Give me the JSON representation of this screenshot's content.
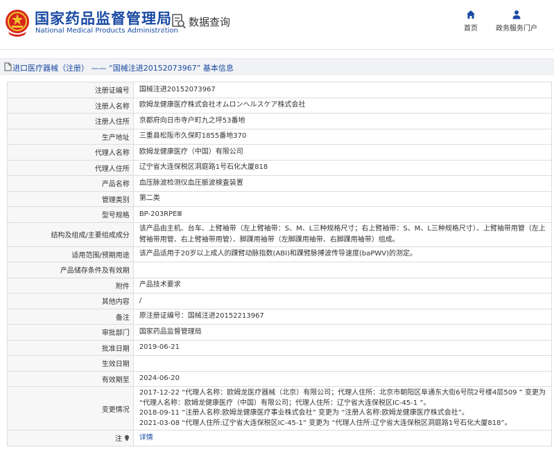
{
  "header": {
    "brand_cn": "国家药品监督管理局",
    "brand_en": "National Medical Products Administration",
    "query_title": "数据查询",
    "nav": [
      {
        "label": "首页",
        "icon": "home-icon"
      },
      {
        "label": "政务服务门户",
        "icon": "user-icon"
      }
    ]
  },
  "breadcrumb": {
    "text": "进口医疗器械（注册） —— “国械注进20152073967” 基本信息"
  },
  "colors": {
    "brand_blue": "#1a4aa3",
    "emblem_red": "#d7261e",
    "emblem_gold": "#f4c430",
    "label_bg": "#f7f7f7",
    "border": "#dcdcdc"
  },
  "detail": {
    "rows": [
      {
        "label": "注册证编号",
        "value": "国械注进20152073967"
      },
      {
        "label": "注册人名称",
        "value": "欧姆龙健康医疗株式会社オムロンヘルスケア株式会社"
      },
      {
        "label": "注册人住所",
        "value": "京都府向日市寺户町九之坪53番地"
      },
      {
        "label": "生产地址",
        "value": "三重县松阪市久保町1855番地370"
      },
      {
        "label": "代理人名称",
        "value": "欧姆龙健康医疗（中国）有限公司"
      },
      {
        "label": "代理人住所",
        "value": "辽宁省大连保税区洞庭路1号石化大厦818"
      },
      {
        "label": "产品名称",
        "value": "血压脉波检测仪血圧脈波検査装置"
      },
      {
        "label": "管理类别",
        "value": "第二类"
      },
      {
        "label": "型号规格",
        "value": "BP-203RPEⅢ"
      },
      {
        "label": "结构及组成/主要组成成分",
        "value": "该产品由主机、台车、上臂袖带（左上臂袖带：S、M、L三种规格尺寸；右上臂袖带：S、M、L三种规格尺寸）、上臂袖带用管（左上臂袖带用管、右上臂袖带用管）、脚踝用袖带（左脚踝用袖带、右脚踝用袖带）组成。"
      },
      {
        "label": "适用范围/预期用途",
        "value": "该产品适用于20岁以上成人的踝臂动脉指数(ABI)和踝臂脉搏波传导速度(baPWV)的测定。"
      },
      {
        "label": "产品储存条件及有效期",
        "value": ""
      },
      {
        "label": "附件",
        "value": "产品技术要求"
      },
      {
        "label": "其他内容",
        "value": "/"
      },
      {
        "label": "备注",
        "value": "原注册证编号：国械注进20152213967"
      },
      {
        "label": "审批部门",
        "value": "国家药品监督管理局"
      },
      {
        "label": "批准日期",
        "value": "2019-06-21"
      },
      {
        "label": "生效日期",
        "value": ""
      },
      {
        "label": "有效期至",
        "value": "2024-06-20"
      }
    ],
    "change_label": "变更情况",
    "changes": [
      "2017-12-22 “代理人名称：欧姆龙医疗器械（北京）有限公司；代理人住所：北京市朝阳区阜通东大街6号院2号楼4层509 ” 变更为",
      "“代理人名称：欧姆龙健康医疗（中国）有限公司；代理人住所：辽宁省大连保税区IC-45-1 ”。",
      "2018-09-11 “注册人名称:欧姆龙健康医疗事业株式会社” 变更为 “注册人名称:欧姆龙健康医疗株式会社”。",
      "2021-03-08 “代理人住所:辽宁省大连保税区IC-45-1” 变更为 “代理人住所:辽宁省大连保税区洞庭路1号石化大厦818”。"
    ],
    "note_label": "注",
    "note_link": "详情"
  }
}
